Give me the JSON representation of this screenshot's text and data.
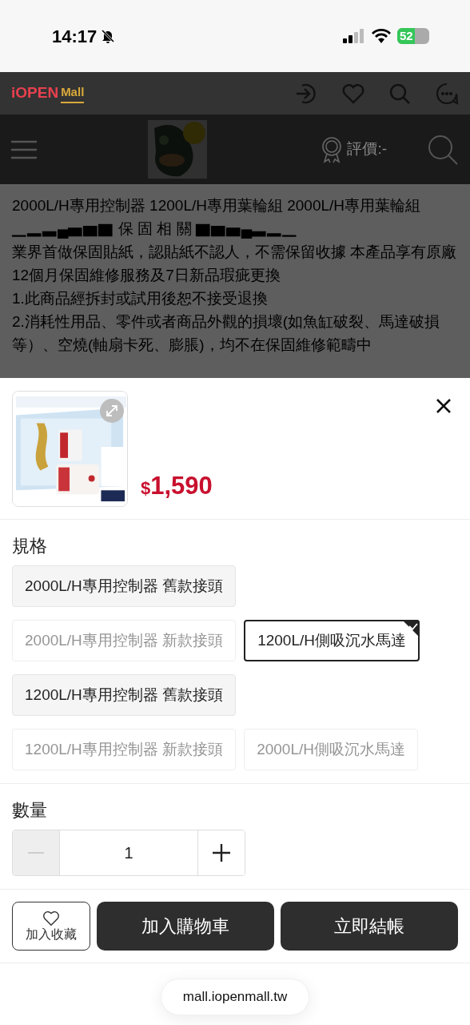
{
  "status_bar": {
    "time": "14:17",
    "battery": "52"
  },
  "site_header": {
    "logo": "iOPEN",
    "logo_badge": "Mall"
  },
  "store_bar": {
    "rating": "評價:-"
  },
  "description": [
    "2000L/H專用控制器 1200L/H專用葉輪組 2000L/H專用葉輪組",
    "▁▂▃▄▅▆▇ 保 固 相 關 ▇▆▅▄▃▂▁",
    "業界首做保固貼紙，認貼紙不認人，不需保留收據 本產品享有原廠12個月保固維修服務及7日新品瑕疵更換",
    "1.此商品經拆封或試用後恕不接受退換",
    "2.消耗性用品、零件或者商品外觀的損壞(如魚缸破裂、馬達破損等）、空燒(軸扇卡死、膨脹)，均不在保固維修範疇中"
  ],
  "sheet": {
    "price_currency": "$",
    "price": "1,590",
    "spec_label": "規格",
    "options": [
      {
        "label": "2000L/H專用控制器 舊款接頭",
        "selected": false,
        "disabled": false
      },
      {
        "label": "2000L/H專用控制器 新款接頭",
        "selected": false,
        "disabled": true
      },
      {
        "label": "1200L/H側吸沉水馬達",
        "selected": true,
        "disabled": false
      },
      {
        "label": "1200L/H專用控制器 舊款接頭",
        "selected": false,
        "disabled": false
      },
      {
        "label": "1200L/H專用控制器 新款接頭",
        "selected": false,
        "disabled": true
      },
      {
        "label": "2000L/H側吸沉水馬達",
        "selected": false,
        "disabled": true
      }
    ],
    "quantity_label": "數量",
    "quantity": "1",
    "minus_disabled": true,
    "buttons": [
      {
        "kind": "favorite",
        "label": "加入收藏"
      },
      {
        "kind": "cart",
        "label": "加入購物車"
      },
      {
        "kind": "checkout",
        "label": "立即結帳"
      }
    ]
  },
  "url": "mall.iopenmall.tw"
}
